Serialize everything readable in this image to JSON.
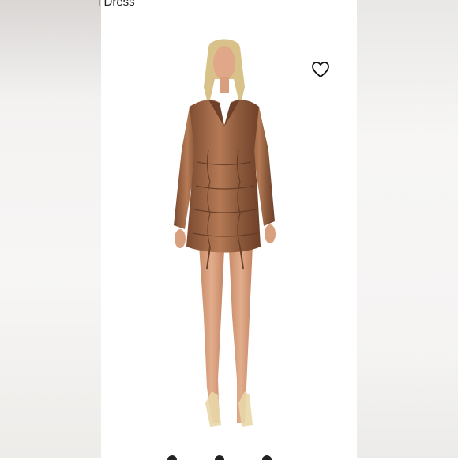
{
  "product": {
    "title_fragment": "l Dress"
  },
  "icons": {
    "wishlist": "heart-outline-icon"
  },
  "colors": {
    "dress": "#8a5638",
    "dress_highlight": "#c48a64",
    "skin": "#d9a07f",
    "hair": "#d8c28a",
    "background": "#ffffff"
  },
  "carousel": {
    "dots": 3
  }
}
